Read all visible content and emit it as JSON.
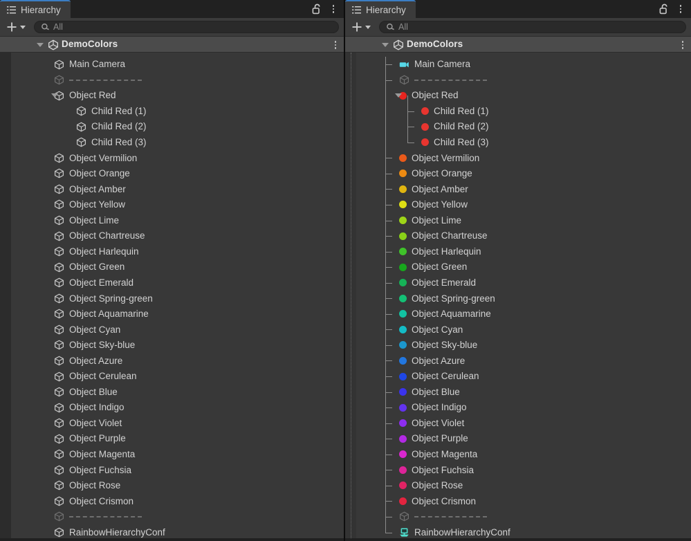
{
  "window": {
    "background": "#383838",
    "accent": "#3b7ec4"
  },
  "panels": [
    {
      "id": "left",
      "tab": {
        "label": "Hierarchy",
        "icon": "hierarchy-list-icon",
        "active": true
      },
      "header_icons": {
        "lock": "lock-open-icon",
        "menu": "kebab-menu-icon"
      },
      "toolbar": {
        "add_label": "+",
        "add_icon": "plus-icon",
        "dropdown_icon": "chevron-down-icon",
        "search": {
          "icon": "search-icon",
          "value": "",
          "placeholder": "All"
        }
      },
      "scene": {
        "name": "DemoColors",
        "icon": "unity-scene-icon",
        "expanded": true,
        "menu_icon": "kebab-menu-icon"
      },
      "show_colors": false,
      "show_branches": false
    },
    {
      "id": "right",
      "tab": {
        "label": "Hierarchy",
        "icon": "hierarchy-list-icon",
        "active": true
      },
      "header_icons": {
        "lock": "lock-open-icon",
        "menu": "kebab-menu-icon"
      },
      "toolbar": {
        "add_label": "+",
        "add_icon": "plus-icon",
        "dropdown_icon": "chevron-down-icon",
        "search": {
          "icon": "search-icon",
          "value": "",
          "placeholder": "All"
        }
      },
      "scene": {
        "name": "DemoColors",
        "icon": "unity-scene-icon",
        "expanded": true,
        "menu_icon": "kebab-menu-icon"
      },
      "show_colors": true,
      "show_branches": true
    }
  ],
  "tree": [
    {
      "name": "Main Camera",
      "depth": 1,
      "icon": "camera-icon",
      "color": "#57d8e8",
      "kind": "camera",
      "expander": "none"
    },
    {
      "name": "---------",
      "depth": 1,
      "icon": "cube-icon",
      "color": "#6f6f6f",
      "kind": "separator",
      "expander": "none",
      "dim": true
    },
    {
      "name": "Object Red",
      "depth": 1,
      "icon": "cube-icon",
      "color": "#e8241f",
      "kind": "object",
      "expander": "expanded"
    },
    {
      "name": "Child Red (1)",
      "depth": 2,
      "icon": "cube-icon",
      "color": "#e8352f",
      "kind": "object",
      "expander": "none"
    },
    {
      "name": "Child Red (2)",
      "depth": 2,
      "icon": "cube-icon",
      "color": "#e8352f",
      "kind": "object",
      "expander": "none"
    },
    {
      "name": "Child Red (3)",
      "depth": 2,
      "icon": "cube-icon",
      "color": "#e8352f",
      "kind": "object",
      "expander": "none"
    },
    {
      "name": "Object Vermilion",
      "depth": 1,
      "icon": "cube-icon",
      "color": "#ea5a1a",
      "kind": "object",
      "expander": "none"
    },
    {
      "name": "Object Orange",
      "depth": 1,
      "icon": "cube-icon",
      "color": "#ec8a12",
      "kind": "object",
      "expander": "none"
    },
    {
      "name": "Object Amber",
      "depth": 1,
      "icon": "cube-icon",
      "color": "#e0b510",
      "kind": "object",
      "expander": "none"
    },
    {
      "name": "Object Yellow",
      "depth": 1,
      "icon": "cube-icon",
      "color": "#dfdf14",
      "kind": "object",
      "expander": "none"
    },
    {
      "name": "Object Lime",
      "depth": 1,
      "icon": "cube-icon",
      "color": "#9ed518",
      "kind": "object",
      "expander": "none"
    },
    {
      "name": "Object Chartreuse",
      "depth": 1,
      "icon": "cube-icon",
      "color": "#8ad118",
      "kind": "object",
      "expander": "none"
    },
    {
      "name": "Object Harlequin",
      "depth": 1,
      "icon": "cube-icon",
      "color": "#3fc22a",
      "kind": "object",
      "expander": "none"
    },
    {
      "name": "Object Green",
      "depth": 1,
      "icon": "cube-icon",
      "color": "#17a71c",
      "kind": "object",
      "expander": "none"
    },
    {
      "name": "Object Emerald",
      "depth": 1,
      "icon": "cube-icon",
      "color": "#16b257",
      "kind": "object",
      "expander": "none"
    },
    {
      "name": "Object Spring-green",
      "depth": 1,
      "icon": "cube-icon",
      "color": "#14c075",
      "kind": "object",
      "expander": "none"
    },
    {
      "name": "Object Aquamarine",
      "depth": 1,
      "icon": "cube-icon",
      "color": "#12c2a2",
      "kind": "object",
      "expander": "none"
    },
    {
      "name": "Object Cyan",
      "depth": 1,
      "icon": "cube-icon",
      "color": "#14bcc6",
      "kind": "object",
      "expander": "none"
    },
    {
      "name": "Object Sky-blue",
      "depth": 1,
      "icon": "cube-icon",
      "color": "#1b97cd",
      "kind": "object",
      "expander": "none"
    },
    {
      "name": "Object Azure",
      "depth": 1,
      "icon": "cube-icon",
      "color": "#2277e0",
      "kind": "object",
      "expander": "none"
    },
    {
      "name": "Object Cerulean",
      "depth": 1,
      "icon": "cube-icon",
      "color": "#1f47e6",
      "kind": "object",
      "expander": "none"
    },
    {
      "name": "Object Blue",
      "depth": 1,
      "icon": "cube-icon",
      "color": "#3b33ed",
      "kind": "object",
      "expander": "none"
    },
    {
      "name": "Object Indigo",
      "depth": 1,
      "icon": "cube-icon",
      "color": "#6233ee",
      "kind": "object",
      "expander": "none"
    },
    {
      "name": "Object Violet",
      "depth": 1,
      "icon": "cube-icon",
      "color": "#8d2df0",
      "kind": "object",
      "expander": "none"
    },
    {
      "name": "Object Purple",
      "depth": 1,
      "icon": "cube-icon",
      "color": "#b229e4",
      "kind": "object",
      "expander": "none"
    },
    {
      "name": "Object Magenta",
      "depth": 1,
      "icon": "cube-icon",
      "color": "#d927ce",
      "kind": "object",
      "expander": "none"
    },
    {
      "name": "Object Fuchsia",
      "depth": 1,
      "icon": "cube-icon",
      "color": "#dd2499",
      "kind": "object",
      "expander": "none"
    },
    {
      "name": "Object Rose",
      "depth": 1,
      "icon": "cube-icon",
      "color": "#e02364",
      "kind": "object",
      "expander": "none"
    },
    {
      "name": "Object Crismon",
      "depth": 1,
      "icon": "cube-icon",
      "color": "#e3243f",
      "kind": "object",
      "expander": "none"
    },
    {
      "name": "---------",
      "depth": 1,
      "icon": "cube-icon",
      "color": "#6f6f6f",
      "kind": "separator",
      "expander": "none",
      "dim": true
    },
    {
      "name": "RainbowHierarchyConf",
      "depth": 1,
      "icon": "script-icon",
      "color": "#4fe0cf",
      "kind": "script",
      "expander": "none"
    }
  ]
}
